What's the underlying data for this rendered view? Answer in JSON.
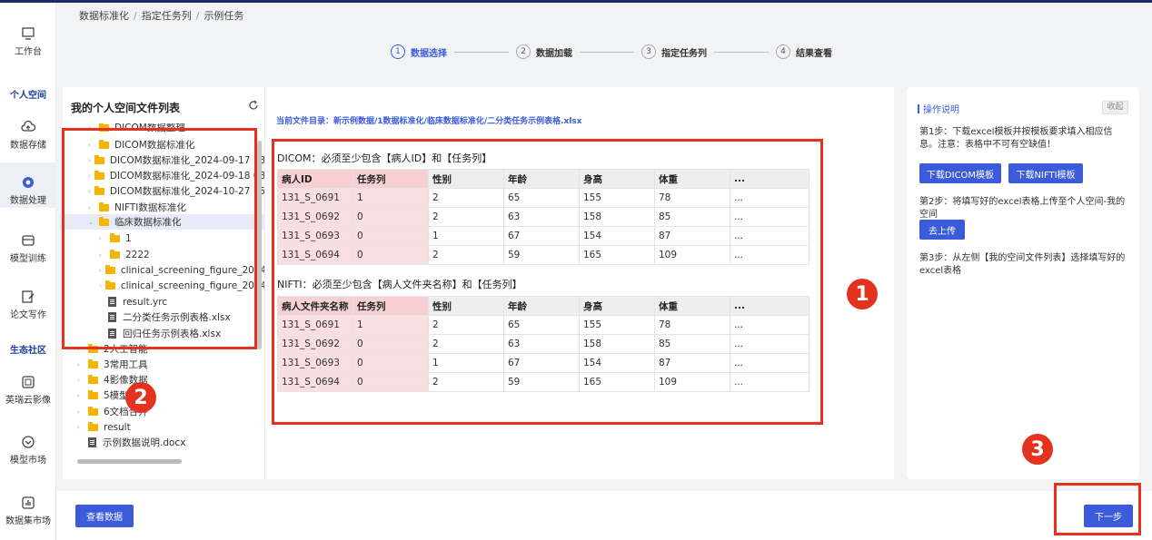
{
  "breadcrumb": [
    "数据标准化",
    "指定任务列",
    "示例任务"
  ],
  "steps": [
    {
      "num": "1",
      "label": "数据选择"
    },
    {
      "num": "2",
      "label": "数据加载"
    },
    {
      "num": "3",
      "label": "指定任务列"
    },
    {
      "num": "4",
      "label": "结果查看"
    }
  ],
  "nav": {
    "workbench": "工作台",
    "section_personal": "个人空间",
    "storage": "数据存储",
    "processing": "数据处理",
    "training": "模型训练",
    "writing": "论文写作",
    "section_community": "生态社区",
    "imaging": "英瑞云影像",
    "model_market": "模型市场",
    "dataset_market": "数据集市场"
  },
  "file_panel": {
    "title": "我的个人空间文件列表",
    "items": [
      {
        "label": "DICOM数据整理",
        "type": "folder",
        "caret": "›"
      },
      {
        "label": "DICOM数据标准化",
        "type": "folder",
        "caret": "›"
      },
      {
        "label": "DICOM数据标准化_2024-09-17 13",
        "type": "folder",
        "caret": "›"
      },
      {
        "label": "DICOM数据标准化_2024-09-18 08",
        "type": "folder",
        "caret": "›"
      },
      {
        "label": "DICOM数据标准化_2024-10-27 15",
        "type": "folder",
        "caret": "›"
      },
      {
        "label": "NIFTI数据标准化",
        "type": "folder",
        "caret": "›"
      },
      {
        "label": "临床数据标准化",
        "type": "folder",
        "caret": "⌄"
      },
      {
        "label": "1",
        "type": "folder",
        "caret": "›"
      },
      {
        "label": "2222",
        "type": "folder",
        "caret": "›"
      },
      {
        "label": "clinical_screening_figure_2024-",
        "type": "folder",
        "caret": "›"
      },
      {
        "label": "clinical_screening_figure_2024-",
        "type": "folder",
        "caret": "›"
      },
      {
        "label": "result.yrc",
        "type": "file",
        "caret": ""
      },
      {
        "label": "二分类任务示例表格.xlsx",
        "type": "file",
        "caret": ""
      },
      {
        "label": "回归任务示例表格.xlsx",
        "type": "file",
        "caret": ""
      },
      {
        "label": "2人工智能",
        "type": "folder",
        "caret": "›"
      },
      {
        "label": "3常用工具",
        "type": "folder",
        "caret": "›"
      },
      {
        "label": "4影像数据",
        "type": "folder",
        "caret": "›"
      },
      {
        "label": "5模型",
        "type": "folder",
        "caret": "›"
      },
      {
        "label": "6文档合并",
        "type": "folder",
        "caret": "›"
      },
      {
        "label": "result",
        "type": "folder",
        "caret": "›"
      },
      {
        "label": "示例数据说明.docx",
        "type": "file",
        "caret": ""
      }
    ]
  },
  "main": {
    "current_dir": "当前文件目录：新示例数据/1数据标准化/临床数据标准化/二分类任务示例表格.xlsx",
    "dicom_title": "DICOM：必须至少包含【病人ID】和【任务列】",
    "dicom_headers": [
      "病人ID",
      "任务列",
      "性别",
      "年龄",
      "身高",
      "体重",
      "..."
    ],
    "dicom_rows": [
      [
        "131_S_0691",
        "1",
        "2",
        "65",
        "155",
        "78",
        "..."
      ],
      [
        "131_S_0692",
        "0",
        "2",
        "63",
        "158",
        "85",
        "..."
      ],
      [
        "131_S_0693",
        "0",
        "1",
        "67",
        "154",
        "87",
        "..."
      ],
      [
        "131_S_0694",
        "0",
        "2",
        "59",
        "165",
        "109",
        "..."
      ]
    ],
    "nifti_title": "NIFTI：必须至少包含【病人文件夹名称】和【任务列】",
    "nifti_headers": [
      "病人文件夹名称",
      "任务列",
      "性别",
      "年龄",
      "身高",
      "体重",
      "..."
    ],
    "nifti_rows": [
      [
        "131_S_0691",
        "1",
        "2",
        "65",
        "155",
        "78",
        "..."
      ],
      [
        "131_S_0692",
        "0",
        "2",
        "63",
        "158",
        "85",
        "..."
      ],
      [
        "131_S_0693",
        "0",
        "1",
        "67",
        "154",
        "87",
        "..."
      ],
      [
        "131_S_0694",
        "0",
        "2",
        "59",
        "165",
        "109",
        "..."
      ]
    ]
  },
  "instructions": {
    "title": "操作说明",
    "collapse": "收起",
    "step1": "第1步：下载excel模板并按模板要求填入相应信息。注意：表格中不可有空缺值！",
    "btn_dicom": "下载DICOM模板",
    "btn_nifti": "下载NIFTI模板",
    "step2": "第2步：将填写好的excel表格上传至个人空间-我的空间",
    "btn_upload": "去上传",
    "step3": "第3步：从左侧【我的空间文件列表】选择填写好的excel表格"
  },
  "footer": {
    "view_data": "查看数据",
    "next": "下一步"
  },
  "annotations": [
    "1",
    "2",
    "3"
  ],
  "colors": {
    "accent": "#3b5bdb",
    "highlight": "#e5321f",
    "folder": "#f5b400"
  }
}
